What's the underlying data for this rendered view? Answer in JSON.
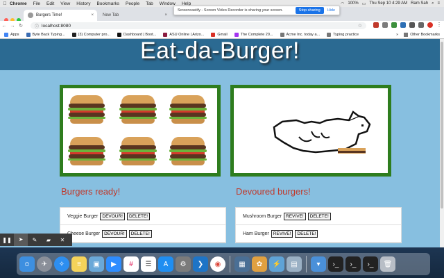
{
  "menubar": {
    "app": "Chrome",
    "items": [
      "File",
      "Edit",
      "View",
      "History",
      "Bookmarks",
      "People",
      "Tab",
      "Window",
      "Help"
    ],
    "battery": "100%",
    "datetime": "Thu Sep 10  4:29 AM",
    "user": "Ram Sah"
  },
  "screencastify": {
    "message": "Screencastify - Screen Video Recorder is sharing your screen.",
    "stop_label": "Stop sharing",
    "hide_label": "Hide"
  },
  "tabs": [
    {
      "title": "Burgers Time!",
      "close": "×"
    },
    {
      "title": "New Tab",
      "close": "×"
    }
  ],
  "address": {
    "url": "localhost:8080",
    "star": "☆"
  },
  "bookmarks": {
    "items": [
      "Apps",
      "Byte Back Typing...",
      "(3) Computer pro...",
      "Dashboard | Boot...",
      "ASU Online | Arizo...",
      "Gmail",
      "The Complete 20...",
      "Acme Inc. today a...",
      "Typing practice"
    ],
    "more": "»",
    "other": "Other Bookmarks"
  },
  "page": {
    "heading": "Eat-da-Burger!",
    "ready_title": "Burgers ready!",
    "devoured_title": "Devoured burgers!",
    "ready": [
      {
        "name": "Veggie Burger",
        "btn1": "DEVOUR!",
        "btn2": "DELETE!"
      },
      {
        "name": "Cheese Burger",
        "btn1": "DEVOUR!",
        "btn2": "DELETE!"
      }
    ],
    "devoured": [
      {
        "name": "Mushroom Burger",
        "btn1": "REVIVE!",
        "btn2": "DELETE!"
      },
      {
        "name": "Ham Burger",
        "btn1": "REVIVE!",
        "btn2": "DELETE!"
      }
    ]
  },
  "annotation_tools": [
    "pause-icon",
    "cursor-icon",
    "pen-icon",
    "eraser-icon",
    "close-icon"
  ],
  "dock": [
    "finder-icon",
    "launchpad-icon",
    "safari-icon",
    "notes-icon",
    "preview-icon",
    "zoom-icon",
    "slack-icon",
    "reminders-icon",
    "appstore-icon",
    "preferences-icon",
    "vscode-icon",
    "chrome-icon",
    "screenshot-icon",
    "paint-icon",
    "network-icon",
    "photos-icon",
    "downloads-icon",
    "terminal-icon",
    "terminal-icon",
    "terminal-icon",
    "trash-icon"
  ]
}
